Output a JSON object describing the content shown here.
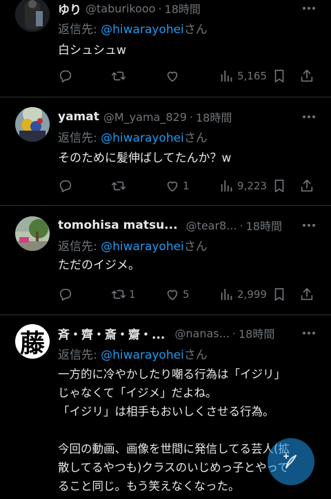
{
  "reply_prefix": "返信先: ",
  "reply_suffix": "さん",
  "tweets": [
    {
      "name": "ゆり",
      "handle": "@taburikooo",
      "time": "18時間",
      "mention": "@hiwarayohei",
      "body": "白シュシュw",
      "replies": "",
      "retweets": "",
      "likes": "",
      "views": "5,165"
    },
    {
      "name": "yamat",
      "handle": "@M_yama_829",
      "time": "18時間",
      "mention": "@hiwarayohei",
      "body": "そのために髪伸ばしてたんか？w",
      "replies": "",
      "retweets": "",
      "likes": "1",
      "views": "9,223"
    },
    {
      "name": "tomohisa matsu...",
      "handle": "@tear8...",
      "time": "18時間",
      "mention": "@hiwarayohei",
      "body": "ただのイジメ。",
      "replies": "",
      "retweets": "1",
      "likes": "5",
      "views": "2,999"
    },
    {
      "name": "斉・齊・斎・齋・...",
      "handle": "@nanas...",
      "time": "18時間",
      "mention": "@hiwarayohei",
      "body_lines": [
        "一方的に冷やかしたり嘲る行為は「イジリ」",
        "じゃなくて「イジメ」だよね。",
        "「イジリ」は相手もおいしくさせる行為。",
        "",
        "今回の動画、画像を世間に発信してる芸人(拡",
        "散してるやつも)クラスのいじめっ子とやって",
        "ること同じ。もう笑えなくなった。"
      ]
    }
  ],
  "avatar4_char": "藤",
  "icons": [
    "more-icon",
    "reply-icon",
    "retweet-icon",
    "like-icon",
    "views-icon",
    "bookmark-icon",
    "share-icon",
    "compose-icon"
  ],
  "colors": {
    "background": "#000000",
    "text": "#e7e9ea",
    "muted": "#71767b",
    "accent": "#1d9bf0",
    "divider": "#2f3336"
  }
}
